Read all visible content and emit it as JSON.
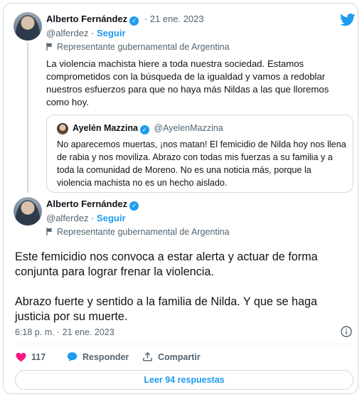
{
  "tweet1": {
    "author_name": "Alberto Fernández",
    "handle": "@alferdez",
    "separator": "·",
    "follow_label": "Seguir",
    "date": "21 ene. 2023",
    "gov_label": "Representante gubernamental de Argentina",
    "text": "La violencia machista hiere a toda nuestra sociedad. Estamos comprometidos con la búsqueda de la igualdad y vamos a redoblar nuestros esfuerzos para que no haya más Nildas a las que lloremos como hoy."
  },
  "quote": {
    "author_name": "Ayelén Mazzina",
    "handle": "@AyelenMazzina",
    "text": "No aparecemos muertas, ¡nos matan! El femicidio de Nilda hoy nos llena de rabia y nos moviliza. Abrazo con todas mis fuerzas a su familia y a toda la comunidad de Moreno. No es una noticia más, porque la violencia machista no es un hecho aislado."
  },
  "tweet2": {
    "author_name": "Alberto Fernández",
    "handle": "@alferdez",
    "separator": "·",
    "follow_label": "Seguir",
    "gov_label": "Representante gubernamental de Argentina",
    "paragraph1": "Este femicidio nos convoca a estar alerta y actuar de forma conjunta para lograr frenar la violencia.",
    "paragraph2": "Abrazo fuerte y sentido a la familia de Nilda. Y que se haga justicia por su muerte.",
    "timestamp": "6:18 p. m. · 21 ene. 2023"
  },
  "actions": {
    "likes": "117",
    "reply_label": "Responder",
    "share_label": "Compartir"
  },
  "read_replies_label": "Leer 94 respuestas",
  "colors": {
    "accent": "#1d9bf0",
    "like": "#f91880",
    "muted": "#536471",
    "border": "#cfd9de"
  },
  "icons": [
    "twitter-bird-icon",
    "verified-badge-icon",
    "flag-icon",
    "info-icon",
    "heart-icon",
    "reply-bubble-icon",
    "share-icon"
  ]
}
